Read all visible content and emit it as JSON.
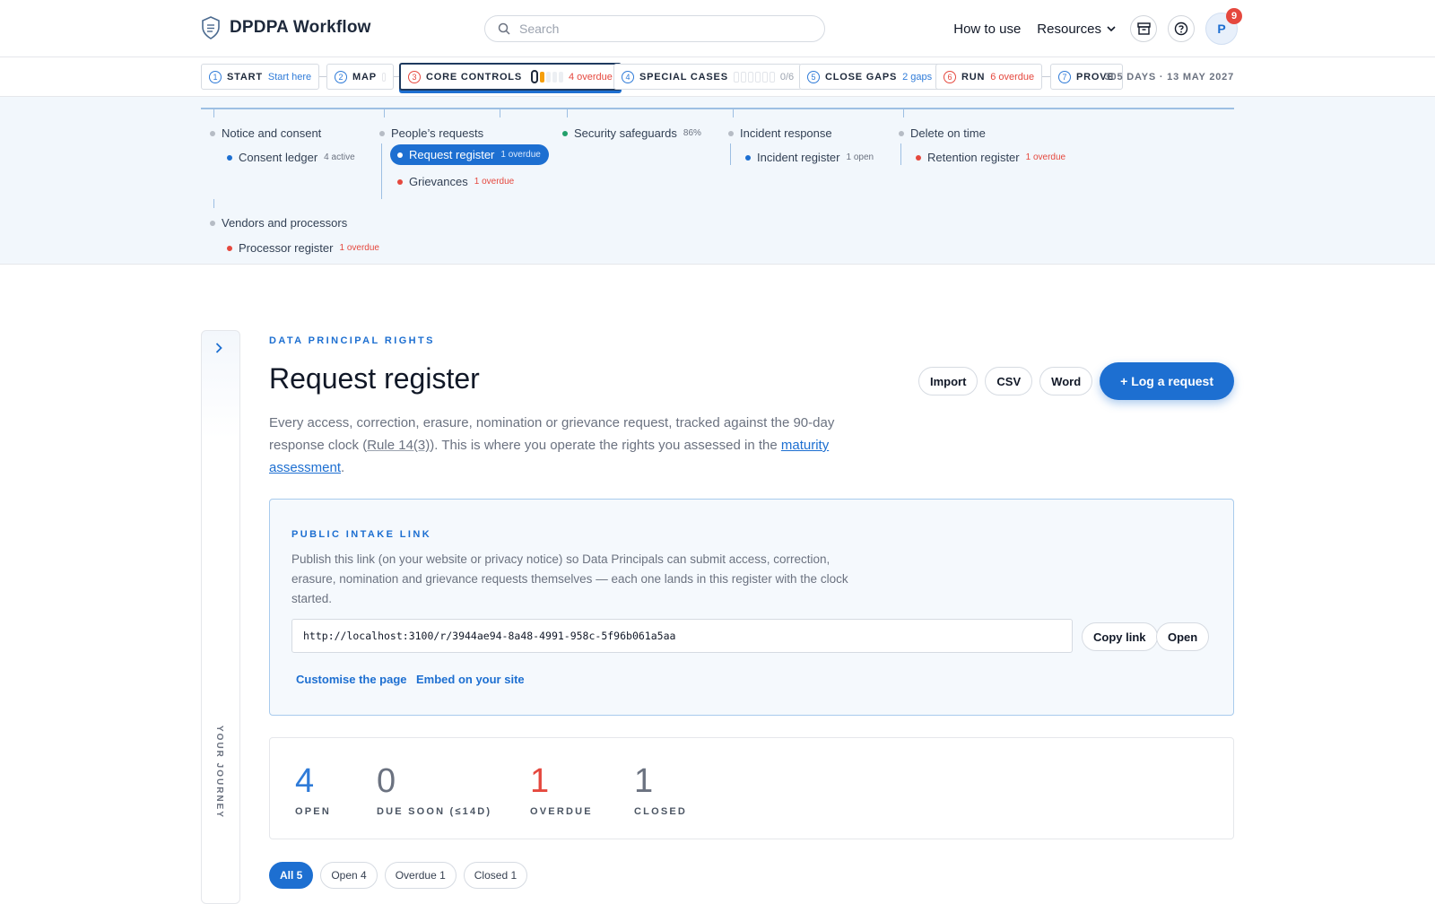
{
  "header": {
    "app_title": "DPDPA Workflow",
    "search_placeholder": "Search",
    "how_to_use": "How to use",
    "resources": "Resources",
    "avatar_initial": "P",
    "notification_count": "9"
  },
  "stepper": {
    "steps": [
      {
        "num": "1",
        "label": "START",
        "sub": "Start here"
      },
      {
        "num": "2",
        "label": "MAP",
        "sub": ""
      },
      {
        "num": "3",
        "label": "CORE CONTROLS",
        "sub": "4 overdue"
      },
      {
        "num": "4",
        "label": "SPECIAL CASES",
        "sub": "0/6"
      },
      {
        "num": "5",
        "label": "CLOSE GAPS",
        "sub": "2 gaps"
      },
      {
        "num": "6",
        "label": "RUN",
        "sub": "6 overdue"
      },
      {
        "num": "7",
        "label": "PROVE",
        "sub": ""
      }
    ],
    "deadline": "305 DAYS · 13 MAY 2027"
  },
  "tree": {
    "notice": {
      "label": "Notice and consent",
      "children": [
        {
          "label": "Consent ledger",
          "meta": "4 active"
        }
      ]
    },
    "people": {
      "label": "People’s requests",
      "children": [
        {
          "label": "Request register",
          "meta": "1 overdue"
        },
        {
          "label": "Grievances",
          "meta": "1 overdue"
        }
      ]
    },
    "security": {
      "label": "Security safeguards",
      "meta": "86%"
    },
    "incident": {
      "label": "Incident response",
      "children": [
        {
          "label": "Incident register",
          "meta": "1 open"
        }
      ]
    },
    "delete": {
      "label": "Delete on time",
      "children": [
        {
          "label": "Retention register",
          "meta": "1 overdue"
        }
      ]
    },
    "vendors": {
      "label": "Vendors and processors",
      "children": [
        {
          "label": "Processor register",
          "meta": "1 overdue"
        }
      ]
    }
  },
  "journey_label": "YOUR JOURNEY",
  "page": {
    "eyebrow": "DATA PRINCIPAL RIGHTS",
    "title": "Request register",
    "desc_part1": "Every access, correction, erasure, nomination or grievance request, tracked against the 90-day response clock (",
    "desc_rule": "Rule 14(3)",
    "desc_part2": "). This is where you operate the rights you assessed in the ",
    "desc_link": "maturity assessment",
    "desc_end": ".",
    "buttons": {
      "import": "Import",
      "csv": "CSV",
      "word": "Word",
      "log": "+ Log a request"
    }
  },
  "intake": {
    "eyebrow": "PUBLIC INTAKE LINK",
    "text": "Publish this link (on your website or privacy notice) so Data Principals can submit access, correction, erasure, nomination and grievance requests themselves — each one lands in this register with the clock started.",
    "url": "http://localhost:3100/r/3944ae94-8a48-4991-958c-5f96b061a5aa",
    "copy": "Copy link",
    "open": "Open",
    "customise": "Customise the page",
    "embed": "Embed on your site"
  },
  "stats": [
    {
      "value": "4",
      "label": "OPEN",
      "color": "#2f7bd8"
    },
    {
      "value": "0",
      "label": "DUE SOON (≤14D)",
      "color": "#6b7280"
    },
    {
      "value": "1",
      "label": "OVERDUE",
      "color": "#e5483e"
    },
    {
      "value": "1",
      "label": "CLOSED",
      "color": "#6b7280"
    }
  ],
  "filters": [
    "All 5",
    "Open 4",
    "Overdue 1",
    "Closed 1"
  ]
}
